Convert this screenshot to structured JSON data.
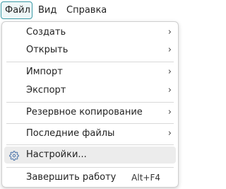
{
  "menubar": {
    "file": "Файл",
    "view": "Вид",
    "help": "Справка"
  },
  "file_menu": {
    "items": [
      {
        "label": "Создать",
        "submenu": true
      },
      {
        "label": "Открыть",
        "submenu": true
      },
      {
        "label": "Импорт",
        "submenu": true
      },
      {
        "label": "Экспорт",
        "submenu": true
      },
      {
        "label": "Резервное копирование",
        "submenu": true
      },
      {
        "label": "Последние файлы",
        "submenu": true
      },
      {
        "label": "Настройки...",
        "icon": "gear-icon"
      },
      {
        "label": "Завершить работу",
        "shortcut": "Alt+F4"
      }
    ]
  },
  "colors": {
    "accent": "#3c9aa6",
    "highlight": "#ececec"
  }
}
